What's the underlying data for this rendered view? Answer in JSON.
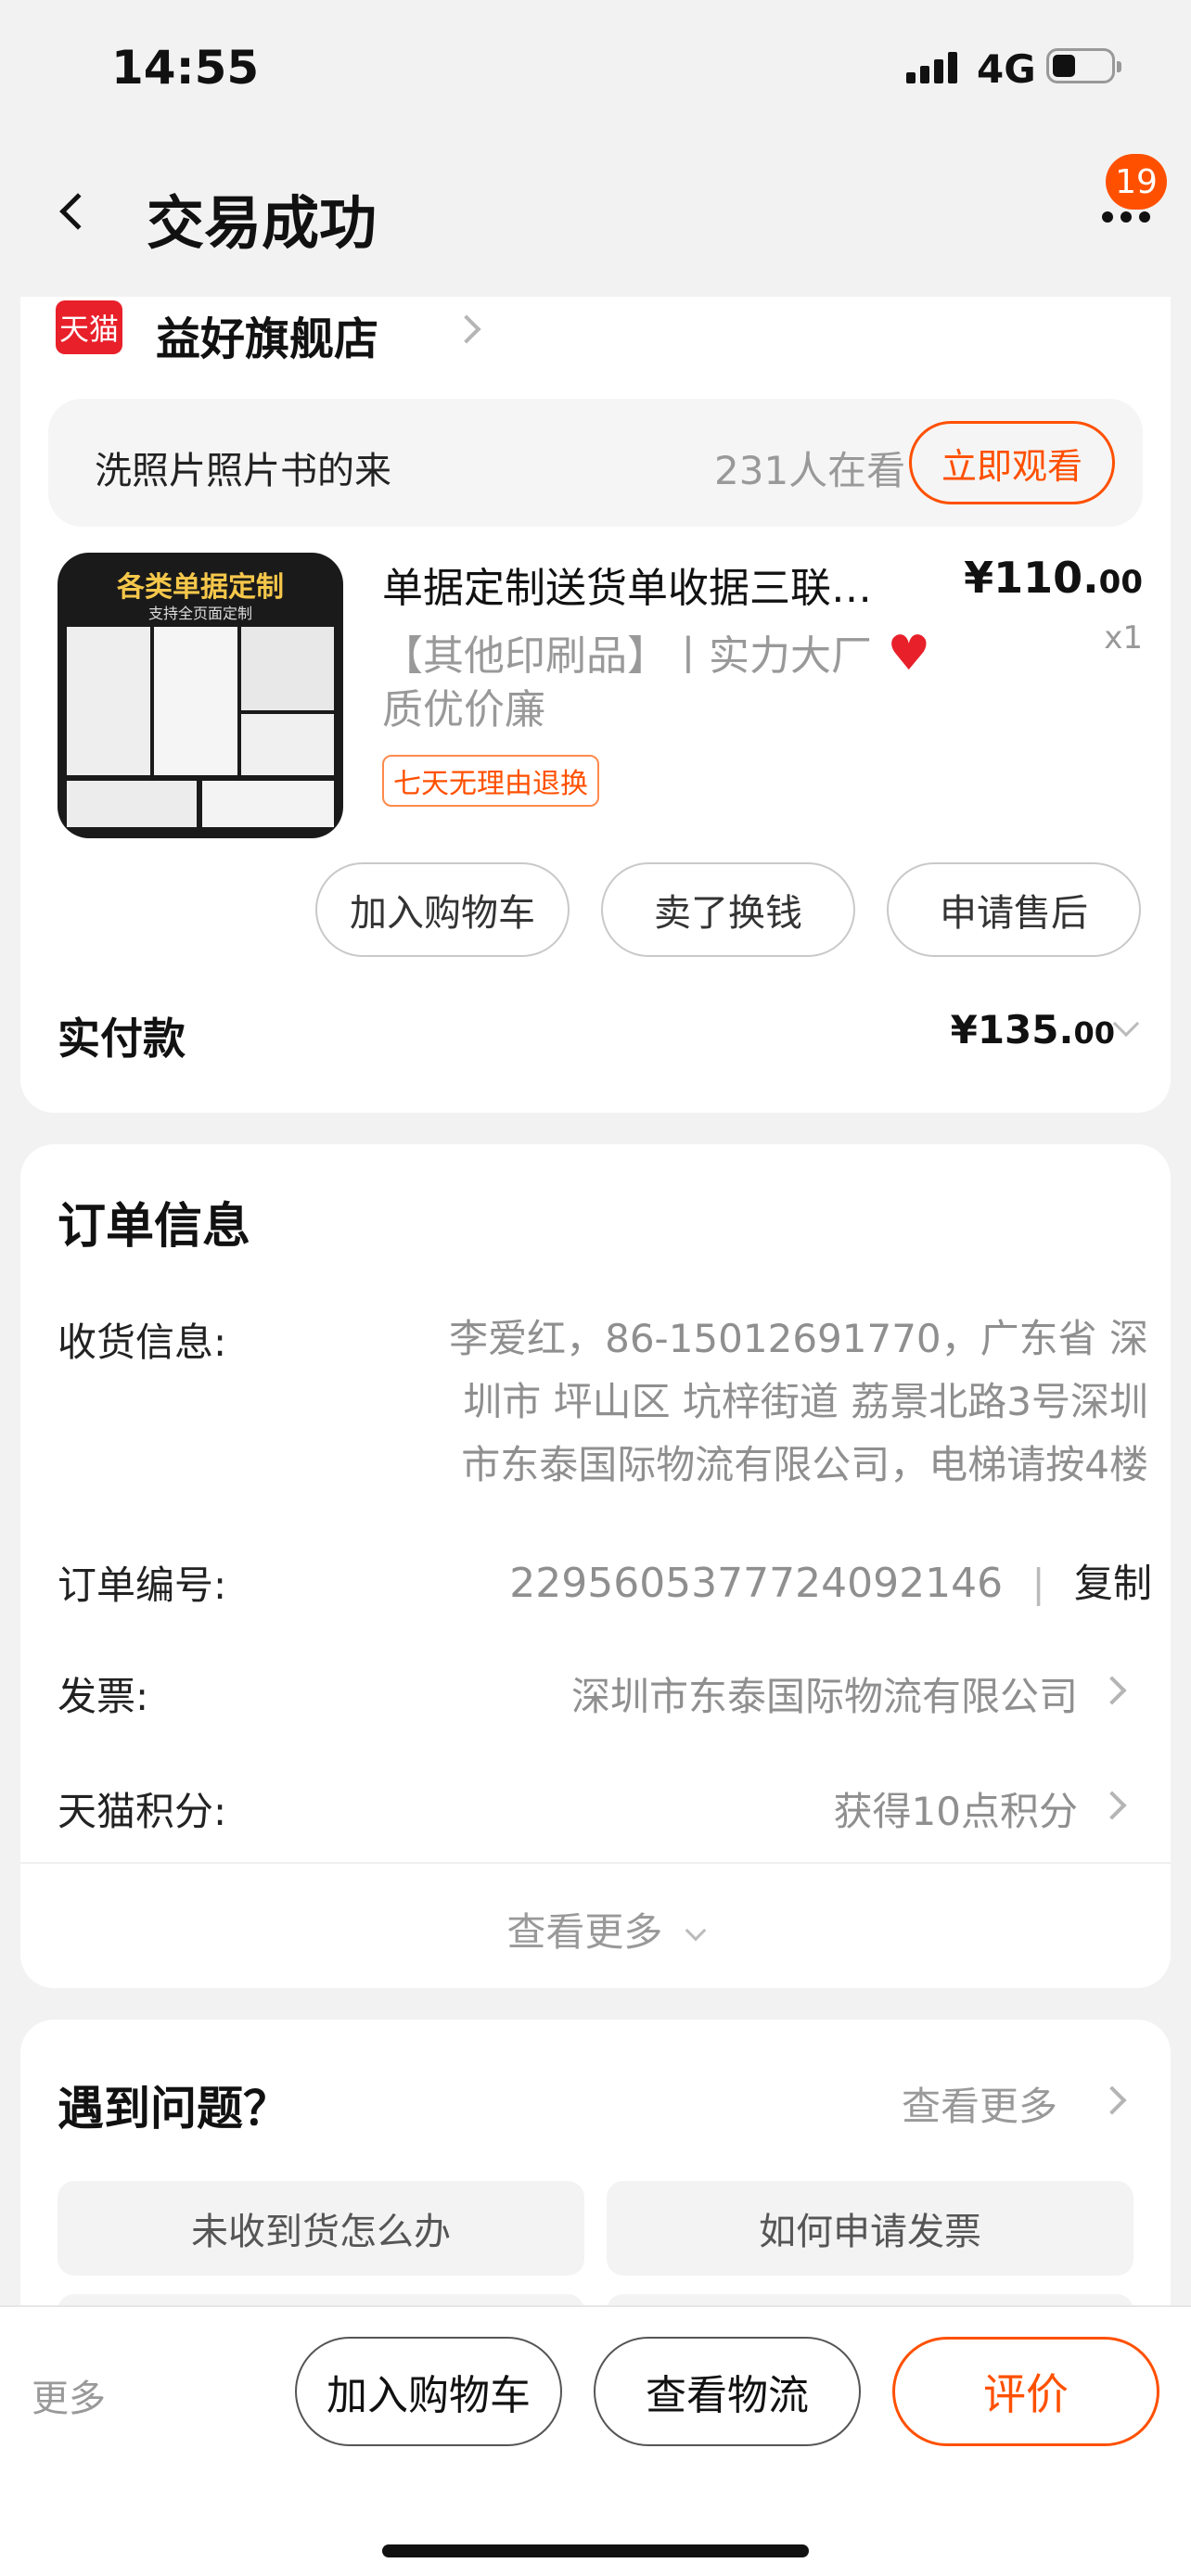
{
  "status_bar": {
    "time": "14:55",
    "network": "4G"
  },
  "header": {
    "title": "交易成功",
    "badge": "19"
  },
  "shop": {
    "logo_text": "天猫",
    "name": "益好旗舰店"
  },
  "live": {
    "text": "洗照片照片书的来",
    "viewers": "231人在看",
    "button": "立即观看"
  },
  "product": {
    "thumb_title": "各类单据定制",
    "thumb_subtitle": "支持全页面定制",
    "title": "单据定制送货单收据三联…",
    "desc_line1": "【其他印刷品】丨实力大厂",
    "desc_line2": "质优价廉",
    "tag": "七天无理由退换",
    "price_int": "¥110.",
    "price_dec": "00",
    "qty": "x1"
  },
  "actions": {
    "add_cart": "加入购物车",
    "sell": "卖了换钱",
    "after_sale": "申请售后"
  },
  "payment": {
    "label": "实付款",
    "amount_int": "¥135.",
    "amount_dec": "00"
  },
  "order": {
    "title": "订单信息",
    "address_label": "收货信息:",
    "address_line1": "李爱红，86-15012691770，广东省 深",
    "address_line2": "圳市 坪山区 坑梓街道 荔景北路3号深圳",
    "address_line3": "市东泰国际物流有限公司，电梯请按4楼",
    "number_label": "订单编号:",
    "number_value": "2295605377724092146",
    "copy": "复制",
    "invoice_label": "发票:",
    "invoice_value": "深圳市东泰国际物流有限公司",
    "points_label": "天猫积分:",
    "points_value": "获得10点积分",
    "more": "查看更多"
  },
  "problems": {
    "title": "遇到问题？",
    "more": "查看更多",
    "items": [
      "未收到货怎么办",
      "如何申请发票"
    ]
  },
  "bottom": {
    "more": "更多",
    "add_cart": "加入购物车",
    "logistics": "查看物流",
    "review": "评价"
  },
  "colors": {
    "accent": "#ff5000",
    "tmall_red": "#e8202a"
  }
}
